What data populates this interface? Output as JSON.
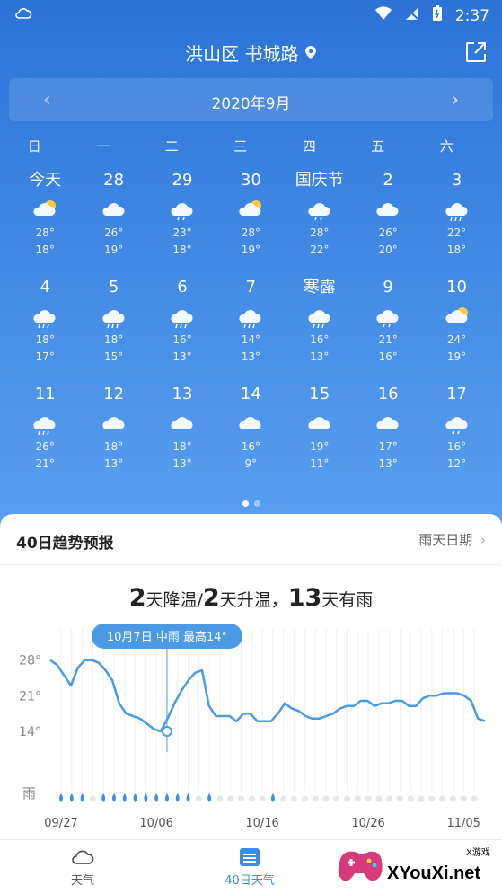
{
  "status": {
    "time": "2:37"
  },
  "location": "洪山区 书城路",
  "month": {
    "label": "2020年9月",
    "prev": "‹",
    "next": "›"
  },
  "weekdays": [
    "日",
    "一",
    "二",
    "三",
    "四",
    "五",
    "六"
  ],
  "weeks": [
    [
      {
        "d": "今天",
        "icon": "cloudy-sun",
        "hi": "28°",
        "lo": "18°"
      },
      {
        "d": "28",
        "icon": "cloudy",
        "hi": "26°",
        "lo": "19°"
      },
      {
        "d": "29",
        "icon": "cloudy-rain-light",
        "hi": "23°",
        "lo": "18°"
      },
      {
        "d": "30",
        "icon": "cloudy-sun",
        "hi": "28°",
        "lo": "19°"
      },
      {
        "d": "国庆节",
        "icon": "cloudy-rain-light",
        "hi": "28°",
        "lo": "22°"
      },
      {
        "d": "2",
        "icon": "cloudy",
        "hi": "26°",
        "lo": "20°"
      },
      {
        "d": "3",
        "icon": "cloudy-rain",
        "hi": "22°",
        "lo": "18°"
      }
    ],
    [
      {
        "d": "4",
        "icon": "cloudy-rain",
        "hi": "18°",
        "lo": "17°"
      },
      {
        "d": "5",
        "icon": "cloudy-rain",
        "hi": "18°",
        "lo": "15°"
      },
      {
        "d": "6",
        "icon": "cloudy-rain",
        "hi": "16°",
        "lo": "13°"
      },
      {
        "d": "7",
        "icon": "cloudy-rain",
        "hi": "14°",
        "lo": "13°"
      },
      {
        "d": "寒露",
        "icon": "cloudy-rain",
        "hi": "16°",
        "lo": "13°"
      },
      {
        "d": "9",
        "icon": "cloudy-rain-light",
        "hi": "21°",
        "lo": "16°"
      },
      {
        "d": "10",
        "icon": "cloudy-sun",
        "hi": "24°",
        "lo": "19°"
      }
    ],
    [
      {
        "d": "11",
        "icon": "cloudy-rain",
        "hi": "26°",
        "lo": "21°"
      },
      {
        "d": "12",
        "icon": "cloudy",
        "hi": "18°",
        "lo": "13°"
      },
      {
        "d": "13",
        "icon": "cloudy",
        "hi": "18°",
        "lo": "13°"
      },
      {
        "d": "14",
        "icon": "cloudy",
        "hi": "16°",
        "lo": "9°"
      },
      {
        "d": "15",
        "icon": "cloudy",
        "hi": "19°",
        "lo": "11°"
      },
      {
        "d": "16",
        "icon": "cloudy",
        "hi": "17°",
        "lo": "13°"
      },
      {
        "d": "17",
        "icon": "cloudy-rain-light",
        "hi": "16°",
        "lo": "12°"
      }
    ]
  ],
  "trend": {
    "title": "40日趋势预报",
    "rain_link": "雨天日期",
    "summary": {
      "n1": "2",
      "t1": "天降温/",
      "n2": "2",
      "t2": "天升温，",
      "n3": "13",
      "t3": "天有雨"
    },
    "tooltip": "10月7日 中雨 最高14°"
  },
  "chart_data": {
    "type": "line",
    "title": "",
    "y_ticks": [
      "28°",
      "21°",
      "14°"
    ],
    "rain_label": "雨",
    "x_ticks": [
      "09/27",
      "10/06",
      "10/16",
      "10/26",
      "11/05"
    ],
    "ylim": [
      8,
      32
    ],
    "days": 40,
    "highlight_index": 10,
    "series": [
      {
        "values": [
          28,
          27,
          25,
          23,
          26.5,
          28,
          28,
          27.5,
          26,
          24,
          19.5,
          17.5,
          17,
          16.5,
          15.5,
          14.5,
          14,
          16.5,
          19.5,
          22,
          24,
          25.5,
          26,
          19,
          17,
          17,
          17,
          16,
          17.5,
          17.5,
          16,
          16,
          16,
          17.5,
          19.5,
          18.5,
          18,
          17,
          16.5,
          16.5,
          17,
          17.5,
          18.5,
          19,
          19,
          20,
          20,
          19,
          19.5,
          19.5,
          20,
          20,
          19,
          19,
          20.5,
          21,
          21,
          21.5,
          21.5,
          21.5,
          21,
          20,
          16.5,
          16
        ]
      }
    ],
    "rain_days": [
      1,
      1,
      1,
      0,
      1,
      1,
      1,
      1,
      1,
      1,
      1,
      1,
      1,
      0,
      1,
      0,
      0,
      0,
      0,
      0,
      1,
      0,
      0,
      0,
      0,
      0,
      0,
      0,
      0,
      0,
      0,
      0,
      0,
      0,
      0,
      0,
      0,
      0,
      0,
      0
    ]
  },
  "tabs": {
    "weather": "天气",
    "forty": "40日天气"
  },
  "watermark": {
    "brand": "XYouXi.net",
    "tag": "X游戏"
  },
  "colors": {
    "accent": "#4a9ae6",
    "top_bg": "#2b73d6"
  }
}
